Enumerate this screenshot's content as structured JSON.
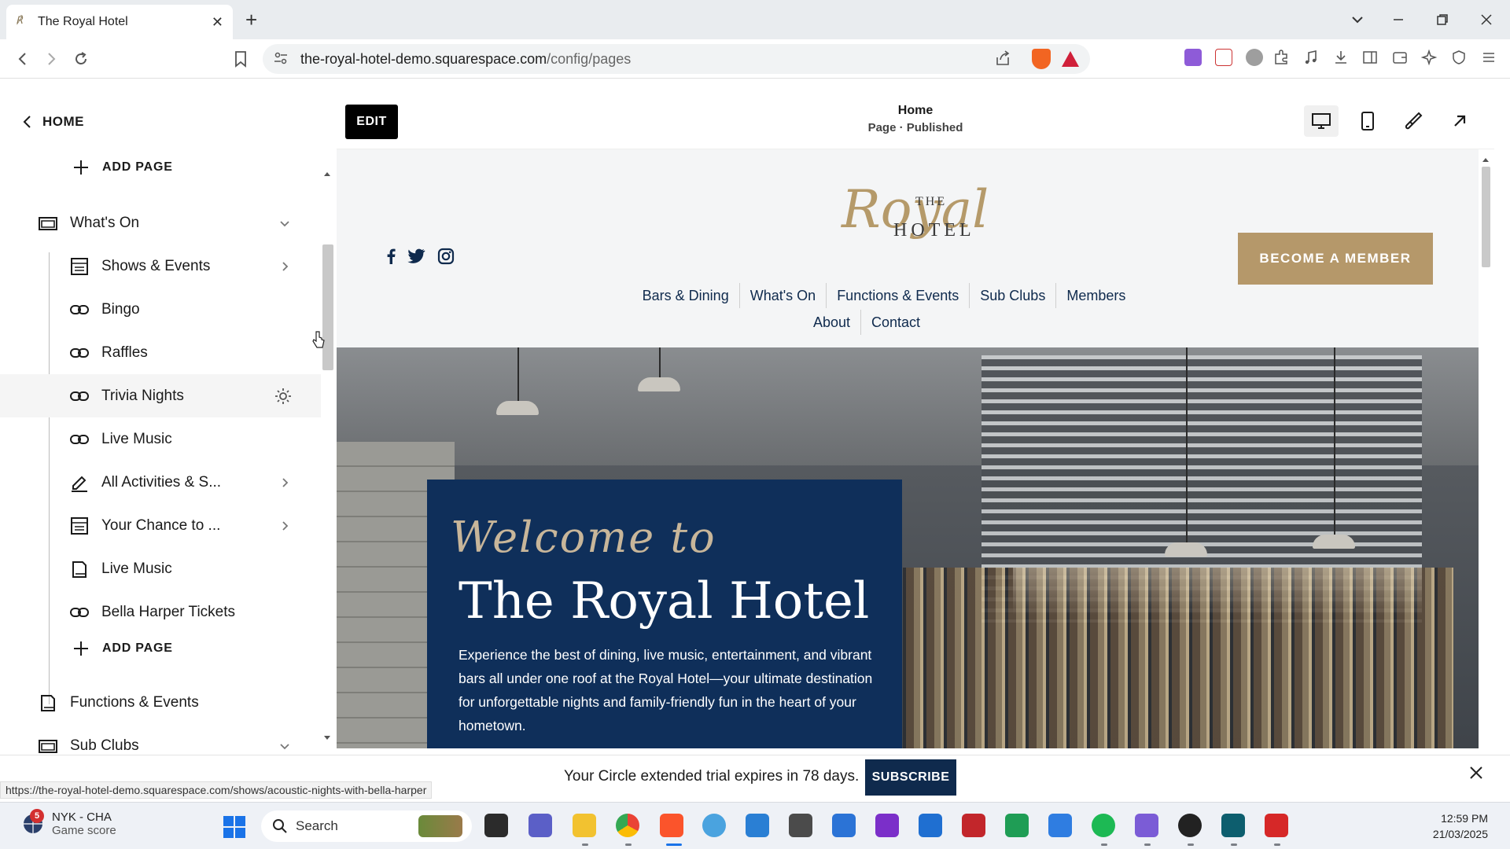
{
  "browser": {
    "tab_title": "The Royal Hotel",
    "favicon_glyph": "℟",
    "url_host": "the-royal-hotel-demo.squarespace.com",
    "url_path": "/config/pages",
    "new_tab_glyph": "+",
    "close_glyph": "✕"
  },
  "left_panel": {
    "back_label": "HOME",
    "items": [
      {
        "label": "ADD PAGE",
        "icon": "plus-icon"
      },
      {
        "label": "What's On",
        "icon": "folder-icon",
        "right": "chevron-down"
      },
      {
        "label": "Shows & Events",
        "icon": "calendar-icon",
        "right": "chevron-right"
      },
      {
        "label": "Bingo",
        "icon": "link-icon"
      },
      {
        "label": "Raffles",
        "icon": "link-icon"
      },
      {
        "label": "Trivia Nights",
        "icon": "link-icon",
        "right": "gear"
      },
      {
        "label": "Live Music",
        "icon": "link-icon"
      },
      {
        "label": "All Activities & S...",
        "icon": "edit-icon",
        "right": "chevron-right"
      },
      {
        "label": "Your Chance to ...",
        "icon": "calendar-icon",
        "right": "chevron-right"
      },
      {
        "label": "Live Music",
        "icon": "page-icon"
      },
      {
        "label": "Bella Harper Tickets",
        "icon": "link-icon"
      },
      {
        "label": "ADD PAGE",
        "icon": "plus-icon"
      },
      {
        "label": "Functions & Events",
        "icon": "page-icon"
      },
      {
        "label": "Sub Clubs",
        "icon": "folder-icon",
        "right": "chevron-down"
      }
    ]
  },
  "preview_toolbar": {
    "edit_label": "EDIT",
    "page_title": "Home",
    "page_status": "Page · Published"
  },
  "site": {
    "logo_script": "Royal",
    "logo_the": "THE",
    "logo_hotel": "HOTEL",
    "member_button": "BECOME A MEMBER",
    "nav_row1": [
      "Bars & Dining",
      "What's On",
      "Functions & Events",
      "Sub Clubs",
      "Members"
    ],
    "nav_row2": [
      "About",
      "Contact"
    ],
    "hero_script": "Welcome to",
    "hero_title": "The Royal Hotel",
    "hero_desc": "Experience the best of dining, live music, entertainment, and vibrant bars all under one roof at the Royal Hotel—your ultimate destination for unforgettable nights and family-friendly fun in the heart of your hometown."
  },
  "trial_bar": {
    "message": "Your Circle extended trial expires in 78 days.",
    "subscribe_label": "SUBSCRIBE"
  },
  "status_url": "https://the-royal-hotel-demo.squarespace.com/shows/acoustic-nights-with-bella-harper",
  "taskbar": {
    "weather_badge": "5",
    "weather_line1": "NYK - CHA",
    "weather_line2": "Game score",
    "search_label": "Search",
    "time": "12:59 PM",
    "date": "21/03/2025"
  },
  "colors": {
    "navy": "#0f2a4d",
    "gold": "#b5986a",
    "hero_box": "#0f2f5a"
  }
}
